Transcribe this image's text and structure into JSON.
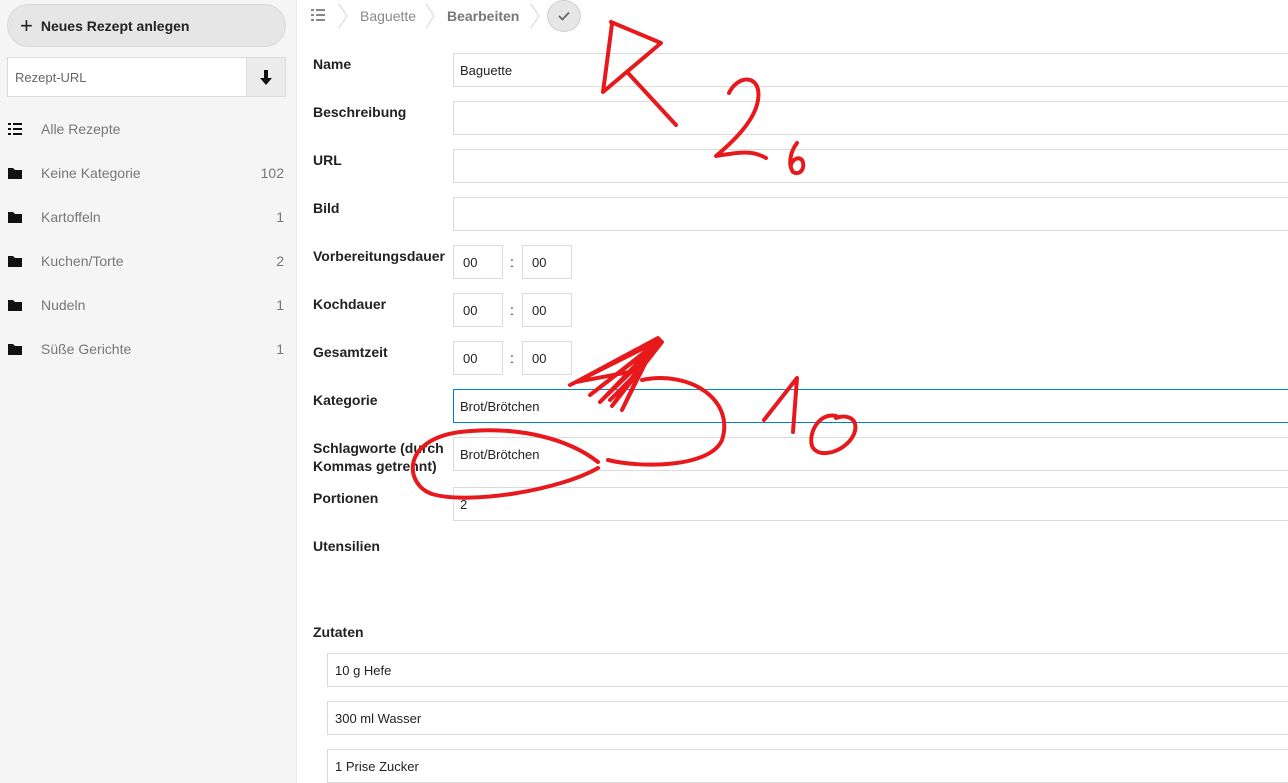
{
  "sidebar": {
    "new_recipe_label": "Neues Rezept anlegen",
    "url_placeholder": "Rezept-URL",
    "items": [
      {
        "label": "Alle Rezepte",
        "count": "",
        "icon": "list-icon"
      },
      {
        "label": "Keine Kategorie",
        "count": "102",
        "icon": "folder-icon"
      },
      {
        "label": "Kartoffeln",
        "count": "1",
        "icon": "folder-icon"
      },
      {
        "label": "Kuchen/Torte",
        "count": "2",
        "icon": "folder-icon"
      },
      {
        "label": "Nudeln",
        "count": "1",
        "icon": "folder-icon"
      },
      {
        "label": "Süße Gerichte",
        "count": "1",
        "icon": "folder-icon"
      }
    ]
  },
  "breadcrumb": {
    "items": [
      "Baguette",
      "Bearbeiten"
    ]
  },
  "form": {
    "name": {
      "label": "Name",
      "value": "Baguette"
    },
    "description": {
      "label": "Beschreibung",
      "value": ""
    },
    "url": {
      "label": "URL",
      "value": ""
    },
    "image": {
      "label": "Bild",
      "value": ""
    },
    "prep_time": {
      "label": "Vorbereitungsdauer",
      "hours": "00",
      "minutes": "00"
    },
    "cook_time": {
      "label": "Kochdauer",
      "hours": "00",
      "minutes": "00"
    },
    "total_time": {
      "label": "Gesamtzeit",
      "hours": "00",
      "minutes": "00"
    },
    "category": {
      "label": "Kategorie",
      "value": "Brot/Brötchen"
    },
    "keywords": {
      "label_line1": "Schlagworte (durch",
      "label_line2": "Kommas getrennt)",
      "value": "Brot/Brötchen"
    },
    "servings": {
      "label": "Portionen",
      "value": "2"
    },
    "tools": {
      "label": "Utensilien"
    },
    "ingredients": {
      "label": "Zutaten",
      "items": [
        "10 g Hefe",
        "300 ml Wasser",
        "1 Prise Zucker"
      ]
    }
  },
  "colors": {
    "annotation": "#e8191d",
    "focus_border": "#0082c9"
  }
}
